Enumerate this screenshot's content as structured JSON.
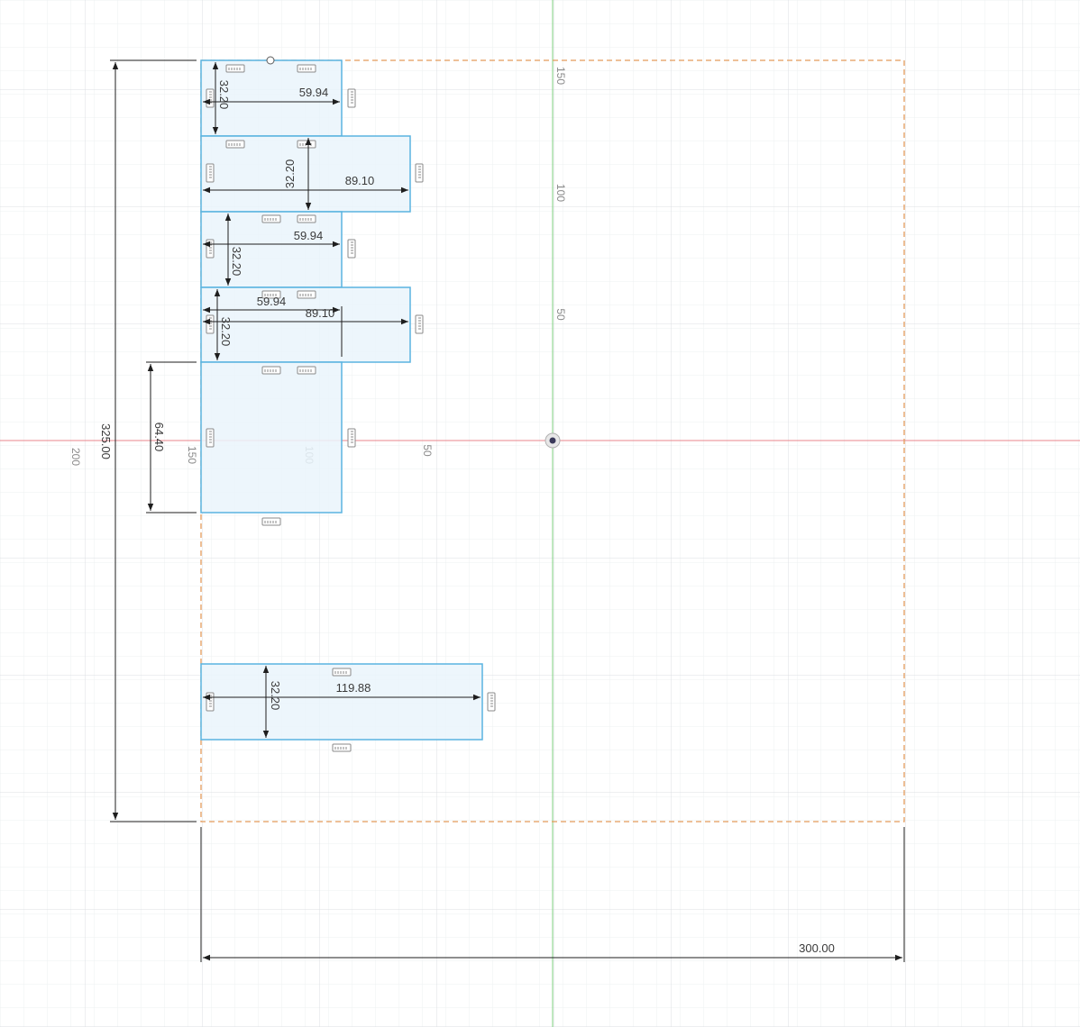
{
  "viewport": {
    "axis_labels": {
      "vertical": [
        "150",
        "100",
        "50"
      ],
      "horizontal": [
        "150",
        "100",
        "50"
      ],
      "outer": "200"
    }
  },
  "dimensions": {
    "stock_height": "325.00",
    "stock_width": "300.00",
    "tall_part_height": "64.40",
    "part1_height": "32.20",
    "part1_width": "59.94",
    "part2_height": "32.20",
    "part2_width": "89.10",
    "part3_height": "32.20",
    "part3_width": "59.94",
    "part4_height": "32.20",
    "part4_width": "89.10",
    "part4_overlap_width": "59.94",
    "part6_height": "32.20",
    "part6_width": "119.88"
  },
  "colors": {
    "grid_minor": "#eef0f2",
    "grid_major": "#dcdfe3",
    "x_axis": "#e8848c",
    "y_axis": "#7fd07f",
    "part_fill": "#eaf4fb",
    "part_stroke": "#5ab4e0",
    "stock_stroke": "#e39a5a",
    "dimension": "#1e1e1e",
    "tab": "#8a8a8a"
  }
}
